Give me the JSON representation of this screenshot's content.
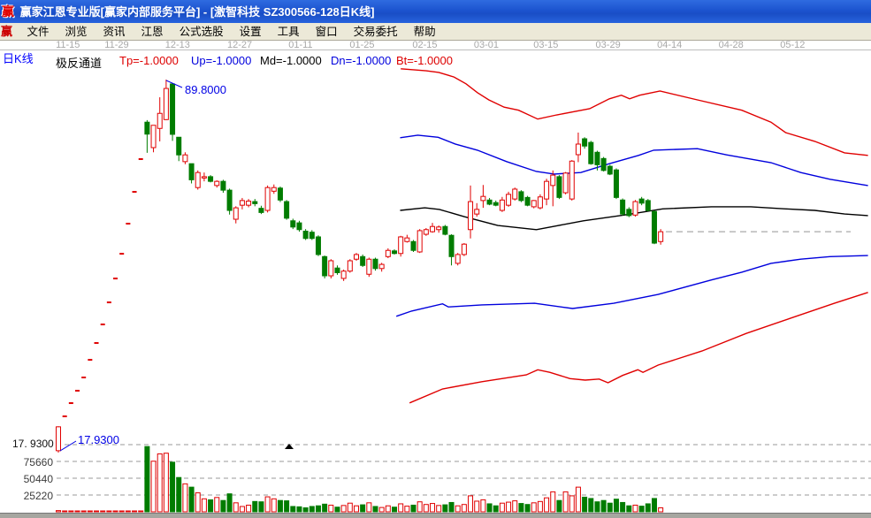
{
  "window": {
    "logo": "赢",
    "title": "赢家江恩专业版[赢家内部服务平台] - [激智科技  SZ300566-128日K线]"
  },
  "menu": {
    "logo": "赢",
    "items": [
      "文件",
      "浏览",
      "资讯",
      "江恩",
      "公式选股",
      "设置",
      "工具",
      "窗口",
      "交易委托",
      "帮助"
    ]
  },
  "header": {
    "kline_label": "日K线"
  },
  "indicator": {
    "name": "极反通道",
    "params": [
      {
        "label": "Tp=-1.0000",
        "color": "#dd0000"
      },
      {
        "label": "Up=-1.0000",
        "color": "#0000dd"
      },
      {
        "label": "Md=-1.0000",
        "color": "#000000"
      },
      {
        "label": "Dn=-1.0000",
        "color": "#0000dd"
      },
      {
        "label": "Bt=-1.0000",
        "color": "#dd0000"
      }
    ],
    "param_x": [
      135,
      216,
      294,
      374,
      448
    ]
  },
  "colors": {
    "up": "#e00000",
    "down": "#007c00",
    "blue_line": "#0000dd",
    "black_line": "#000000",
    "annotation": "#0000e6",
    "grid": "#999999",
    "date_text": "#a8a8a8"
  },
  "chart_data": {
    "type": "candlestick+volume",
    "symbol": "SZ300566",
    "stock_name": "激智科技",
    "period": "日K线",
    "bars_window": 128,
    "x_ticks": [
      {
        "label": "11-15",
        "i": 1.5
      },
      {
        "label": "11-29",
        "i": 9.2
      },
      {
        "label": "12-13",
        "i": 18.8
      },
      {
        "label": "12-27",
        "i": 28.6
      },
      {
        "label": "01-11",
        "i": 38.2
      },
      {
        "label": "01-25",
        "i": 47.9
      },
      {
        "label": "02-15",
        "i": 57.8
      },
      {
        "label": "03-01",
        "i": 67.5
      },
      {
        "label": "03-15",
        "i": 76.9
      },
      {
        "label": "03-29",
        "i": 86.7
      },
      {
        "label": "04-14",
        "i": 96.4
      },
      {
        "label": "04-28",
        "i": 106.1
      },
      {
        "label": "05-12",
        "i": 115.8
      }
    ],
    "price_annotations": {
      "high": {
        "label": "89.8000",
        "value": 89.8,
        "i": 17
      },
      "low": {
        "label": "17.9300",
        "value": 17.93,
        "i": 0
      },
      "axis_low_label": "17. 9300"
    },
    "volume_axis": {
      "labels": [
        {
          "text": "75660",
          "value": 75660
        },
        {
          "text": "50440",
          "value": 50440
        },
        {
          "text": "25220",
          "value": 25220
        }
      ],
      "grid_values": [
        100880,
        75660,
        50440,
        25220
      ]
    },
    "last_close": 60.5,
    "marker": {
      "glyph": "triangle-up",
      "i": 36.4
    },
    "candles": [
      [
        18.3,
        23.0,
        17.93,
        22.9
      ],
      [
        24.92,
        24.92,
        24.92,
        24.92
      ],
      [
        27.47,
        27.47,
        27.47,
        27.47
      ],
      [
        29.86,
        29.86,
        29.86,
        29.86
      ],
      [
        32.41,
        32.41,
        32.41,
        32.41
      ],
      [
        35.81,
        35.81,
        35.81,
        35.81
      ],
      [
        39.05,
        39.05,
        39.05,
        39.05
      ],
      [
        42.63,
        42.63,
        42.63,
        42.63
      ],
      [
        46.88,
        46.88,
        46.88,
        46.88
      ],
      [
        51.48,
        51.48,
        51.48,
        51.48
      ],
      [
        56.25,
        56.25,
        56.25,
        56.25
      ],
      [
        62.05,
        62.05,
        62.05,
        62.05
      ],
      [
        68.18,
        68.18,
        68.18,
        68.18
      ],
      [
        74.49,
        74.49,
        74.49,
        74.49
      ],
      [
        81.6,
        82.0,
        75.7,
        79.3
      ],
      [
        76.7,
        81.0,
        75.8,
        81.0
      ],
      [
        80.4,
        86.4,
        77.9,
        83.3
      ],
      [
        82.1,
        89.8,
        82.0,
        88.1
      ],
      [
        88.97,
        88.97,
        78.0,
        79.26
      ],
      [
        78.7,
        78.7,
        74.1,
        75.3
      ],
      [
        74.0,
        75.8,
        73.5,
        75.3
      ],
      [
        73.6,
        73.6,
        69.8,
        70.5
      ],
      [
        69.0,
        72.3,
        68.6,
        71.9
      ],
      [
        70.9,
        71.9,
        70.2,
        71.1
      ],
      [
        71.1,
        71.4,
        70.0,
        70.2
      ],
      [
        69.4,
        70.4,
        69.0,
        70.2
      ],
      [
        70.2,
        70.5,
        68.0,
        68.5
      ],
      [
        68.5,
        68.8,
        63.8,
        64.6
      ],
      [
        62.9,
        65.4,
        62.1,
        65.1
      ],
      [
        65.6,
        67.0,
        64.8,
        66.5
      ],
      [
        65.6,
        66.8,
        65.2,
        66.4
      ],
      [
        66.3,
        66.8,
        65.4,
        65.9
      ],
      [
        65.0,
        65.5,
        63.9,
        64.2
      ],
      [
        64.6,
        69.4,
        64.2,
        69.0
      ],
      [
        68.3,
        69.6,
        67.8,
        69.0
      ],
      [
        68.9,
        69.2,
        66.2,
        66.6
      ],
      [
        66.3,
        66.6,
        62.8,
        63.1
      ],
      [
        62.6,
        63.0,
        61.0,
        61.4
      ],
      [
        62.2,
        62.6,
        60.5,
        60.9
      ],
      [
        60.6,
        61.0,
        58.9,
        59.2
      ],
      [
        60.4,
        60.8,
        58.9,
        59.2
      ],
      [
        59.5,
        59.8,
        55.8,
        56.1
      ],
      [
        55.7,
        55.9,
        51.5,
        52.0
      ],
      [
        52.0,
        55.2,
        51.5,
        54.9
      ],
      [
        53.5,
        54.0,
        52.2,
        52.6
      ],
      [
        51.5,
        53.2,
        51.0,
        52.9
      ],
      [
        52.9,
        55.2,
        52.6,
        54.9
      ],
      [
        55.2,
        56.4,
        54.9,
        56.1
      ],
      [
        55.7,
        56.1,
        53.7,
        54.0
      ],
      [
        52.3,
        55.5,
        51.8,
        55.2
      ],
      [
        55.2,
        55.5,
        53.0,
        53.4
      ],
      [
        53.4,
        54.5,
        52.8,
        54.2
      ],
      [
        55.7,
        57.3,
        55.4,
        56.9
      ],
      [
        56.8,
        57.1,
        56.1,
        56.3
      ],
      [
        56.3,
        59.7,
        55.7,
        59.5
      ],
      [
        58.6,
        59.9,
        58.4,
        59.3
      ],
      [
        58.6,
        58.9,
        56.6,
        56.9
      ],
      [
        56.6,
        61.0,
        56.4,
        60.7
      ],
      [
        60.0,
        61.2,
        59.7,
        60.9
      ],
      [
        60.5,
        62.2,
        60.3,
        61.5
      ],
      [
        60.9,
        61.7,
        60.3,
        61.4
      ],
      [
        61.5,
        61.8,
        59.8,
        60.0
      ],
      [
        59.8,
        60.0,
        54.0,
        55.7
      ],
      [
        54.4,
        56.4,
        54.0,
        56.1
      ],
      [
        56.1,
        58.3,
        55.8,
        58.1
      ],
      [
        60.9,
        69.4,
        59.2,
        66.3
      ],
      [
        63.9,
        66.0,
        63.4,
        64.8
      ],
      [
        66.5,
        69.5,
        65.1,
        67.3
      ],
      [
        66.6,
        67.0,
        65.6,
        65.8
      ],
      [
        66.1,
        66.5,
        65.4,
        65.6
      ],
      [
        64.6,
        67.2,
        64.3,
        66.6
      ],
      [
        65.6,
        68.2,
        65.3,
        67.7
      ],
      [
        66.8,
        69.0,
        66.5,
        68.7
      ],
      [
        68.2,
        68.5,
        66.2,
        66.5
      ],
      [
        67.1,
        67.4,
        65.4,
        65.6
      ],
      [
        65.3,
        66.6,
        65.0,
        66.5
      ],
      [
        65.1,
        67.7,
        64.8,
        67.2
      ],
      [
        66.8,
        70.7,
        65.6,
        70.2
      ],
      [
        69.4,
        72.3,
        65.4,
        71.4
      ],
      [
        71.1,
        71.4,
        66.8,
        67.1
      ],
      [
        68.0,
        72.0,
        67.7,
        71.8
      ],
      [
        66.8,
        74.3,
        66.5,
        74.1
      ],
      [
        75.34,
        79.6,
        73.9,
        77.38
      ],
      [
        78.4,
        78.7,
        76.5,
        77.0
      ],
      [
        77.7,
        78.0,
        73.4,
        73.6
      ],
      [
        75.8,
        76.1,
        72.3,
        73.4
      ],
      [
        74.6,
        74.9,
        72.1,
        72.3
      ],
      [
        73.1,
        73.4,
        71.4,
        71.6
      ],
      [
        72.4,
        72.7,
        66.8,
        67.1
      ],
      [
        66.6,
        66.9,
        63.6,
        63.9
      ],
      [
        64.8,
        65.2,
        63.3,
        63.6
      ],
      [
        63.7,
        66.6,
        63.4,
        66.3
      ],
      [
        66.8,
        67.2,
        65.6,
        66.0
      ],
      [
        66.5,
        66.8,
        64.4,
        64.6
      ],
      [
        64.4,
        64.6,
        58.1,
        58.3
      ],
      [
        58.6,
        61.0,
        58.0,
        60.5
      ]
    ],
    "volumes": [
      1800,
      400,
      350,
      300,
      380,
      320,
      360,
      300,
      340,
      310,
      330,
      300,
      320,
      350,
      98000,
      76000,
      87000,
      88000,
      74500,
      51500,
      42000,
      37000,
      28500,
      19500,
      18000,
      21500,
      17000,
      27000,
      13500,
      8000,
      10000,
      15500,
      15000,
      22500,
      19500,
      17000,
      16500,
      8000,
      7500,
      6000,
      8000,
      9000,
      11500,
      10000,
      7000,
      9500,
      13000,
      9000,
      10500,
      13500,
      8000,
      6500,
      9000,
      7000,
      12000,
      8500,
      10000,
      15000,
      11000,
      12500,
      9500,
      10500,
      14000,
      9000,
      11000,
      24000,
      16000,
      18000,
      12000,
      9000,
      13000,
      14500,
      16500,
      12500,
      11000,
      13500,
      15500,
      21000,
      30000,
      17000,
      30000,
      24000,
      37000,
      22000,
      20000,
      15000,
      17000,
      13000,
      19000,
      14000,
      9000,
      10000,
      8500,
      12000,
      20000,
      6000
    ],
    "lines": {
      "tp": [
        [
          54,
          91.9
        ],
        [
          58,
          91.5
        ],
        [
          60,
          91.2
        ],
        [
          62.4,
          90.3
        ],
        [
          64.3,
          89.0
        ],
        [
          66.1,
          87.3
        ],
        [
          67.9,
          85.9
        ],
        [
          70.3,
          84.5
        ],
        [
          72.6,
          83.9
        ],
        [
          75.6,
          82.2
        ],
        [
          78.6,
          83.0
        ],
        [
          83.8,
          84.2
        ],
        [
          86.9,
          86.1
        ],
        [
          88.8,
          86.8
        ],
        [
          90.1,
          86.1
        ],
        [
          91.7,
          86.8
        ],
        [
          94.9,
          87.6
        ],
        [
          100.8,
          85.9
        ],
        [
          107.8,
          83.9
        ],
        [
          112.4,
          81.6
        ],
        [
          114.7,
          79.6
        ],
        [
          119.3,
          77.9
        ],
        [
          124,
          75.7
        ],
        [
          127.7,
          75.2
        ]
      ],
      "up": [
        [
          53.9,
          78.6
        ],
        [
          56.7,
          79.1
        ],
        [
          59.9,
          78.7
        ],
        [
          62.6,
          77.4
        ],
        [
          66.1,
          76.2
        ],
        [
          70.7,
          74.0
        ],
        [
          75.4,
          72.1
        ],
        [
          78.2,
          71.6
        ],
        [
          82.4,
          71.9
        ],
        [
          86.9,
          73.6
        ],
        [
          91.5,
          75.2
        ],
        [
          93.9,
          76.2
        ],
        [
          100.8,
          76.5
        ],
        [
          105.4,
          75.3
        ],
        [
          112.4,
          73.8
        ],
        [
          117.1,
          71.9
        ],
        [
          121.7,
          70.6
        ],
        [
          127.7,
          69.4
        ]
      ],
      "md": [
        [
          53.9,
          64.6
        ],
        [
          57.8,
          65.1
        ],
        [
          60.1,
          64.8
        ],
        [
          64,
          63.4
        ],
        [
          69.3,
          61.7
        ],
        [
          75.4,
          60.9
        ],
        [
          82.8,
          62.6
        ],
        [
          89.8,
          63.8
        ],
        [
          95.3,
          64.9
        ],
        [
          103,
          65.3
        ],
        [
          109.2,
          65.3
        ],
        [
          114.7,
          64.9
        ],
        [
          119.3,
          64.6
        ],
        [
          124,
          63.9
        ],
        [
          127.7,
          63.6
        ]
      ],
      "dn": [
        [
          53.3,
          44.2
        ],
        [
          55.7,
          45.2
        ],
        [
          60.6,
          46.6
        ],
        [
          61.5,
          46.0
        ],
        [
          66.8,
          46.4
        ],
        [
          75.1,
          46.7
        ],
        [
          81.1,
          45.7
        ],
        [
          87.6,
          46.7
        ],
        [
          94.6,
          48.4
        ],
        [
          103,
          51.2
        ],
        [
          107.8,
          52.7
        ],
        [
          112.4,
          54.4
        ],
        [
          117.1,
          55.2
        ],
        [
          121.7,
          55.7
        ],
        [
          127.7,
          55.9
        ]
      ],
      "bt": [
        [
          55.4,
          27.5
        ],
        [
          60.6,
          30.2
        ],
        [
          66.8,
          31.6
        ],
        [
          73.8,
          32.9
        ],
        [
          75.6,
          33.9
        ],
        [
          77.5,
          33.4
        ],
        [
          80.7,
          32.2
        ],
        [
          83.1,
          31.9
        ],
        [
          85.3,
          32.1
        ],
        [
          86.7,
          31.4
        ],
        [
          89,
          32.8
        ],
        [
          91.4,
          33.9
        ],
        [
          92.2,
          33.4
        ],
        [
          94.6,
          34.8
        ],
        [
          101.5,
          37.5
        ],
        [
          108.5,
          40.9
        ],
        [
          115.4,
          43.8
        ],
        [
          122.4,
          46.7
        ],
        [
          127.7,
          48.8
        ]
      ]
    }
  }
}
